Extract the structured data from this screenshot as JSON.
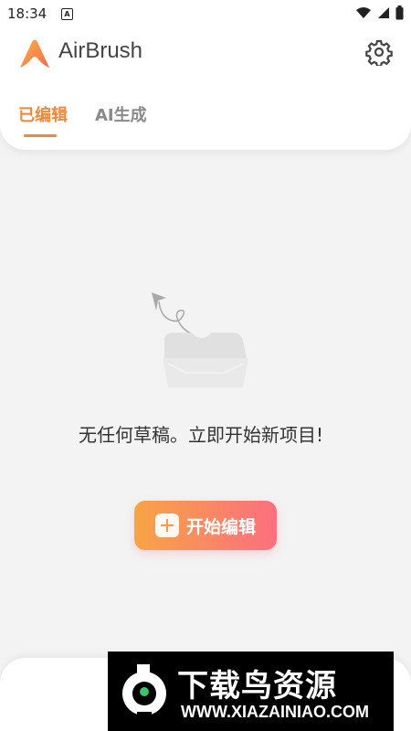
{
  "status": {
    "time": "18:34",
    "a_icon": "A"
  },
  "header": {
    "app_name": "AirBrush",
    "tabs": [
      {
        "label": "已编辑",
        "active": true
      },
      {
        "label": "AI生成",
        "active": false
      }
    ]
  },
  "empty": {
    "message": "无任何草稿。立即开始新项目!"
  },
  "actions": {
    "start_label": "开始编辑"
  },
  "watermark": {
    "title": "下载鸟资源",
    "url": "WWW.XIAZAINIAO.COM"
  },
  "colors": {
    "accent": "#f0883a",
    "gradient_start": "#f7a445",
    "gradient_end": "#fb6f7f"
  }
}
